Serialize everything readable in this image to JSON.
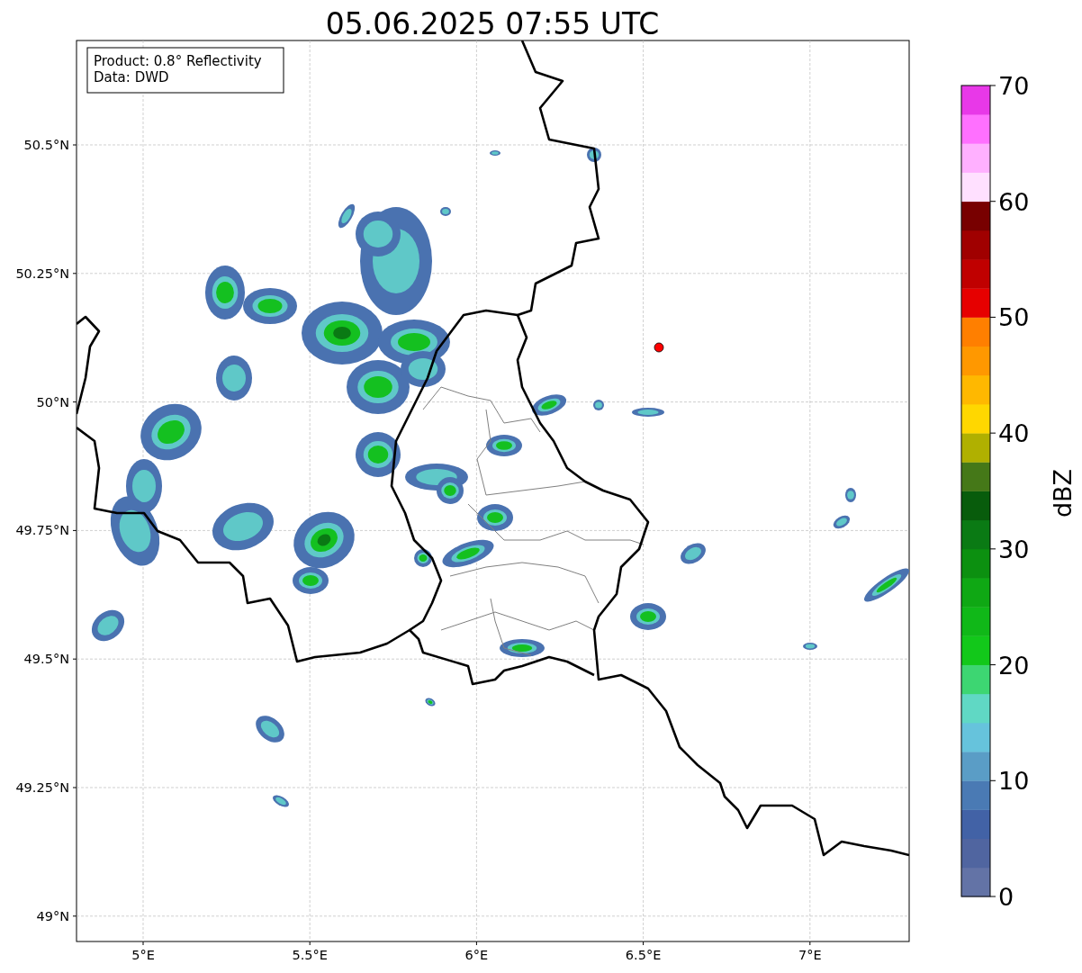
{
  "title": "05.06.2025 07:55 UTC",
  "annotation": {
    "lines": [
      "Product: 0.8° Reflectivity",
      "Data: DWD"
    ]
  },
  "map": {
    "y_tick_labels": [
      "50.5°N",
      "50.25°N",
      "50°N",
      "49.75°N",
      "49.5°N",
      "49.25°N",
      "49°N"
    ],
    "x_tick_labels": [
      "5°E",
      "5.5°E",
      "6°E",
      "6.5°E",
      "7°E"
    ]
  },
  "colorbar": {
    "label": "dBZ",
    "tick_labels": [
      "70",
      "60",
      "50",
      "40",
      "30",
      "20",
      "10",
      "0"
    ],
    "segments": [
      {
        "color": "#6373a6"
      },
      {
        "color": "#5065a0"
      },
      {
        "color": "#4262a6"
      },
      {
        "color": "#4a7ab4"
      },
      {
        "color": "#5a9dc6"
      },
      {
        "color": "#66c3dc"
      },
      {
        "color": "#60d8c4"
      },
      {
        "color": "#3dd672"
      },
      {
        "color": "#12c81a"
      },
      {
        "color": "#10b818"
      },
      {
        "color": "#0fa814"
      },
      {
        "color": "#0c9010"
      },
      {
        "color": "#0a7a14"
      },
      {
        "color": "#085c0c"
      },
      {
        "color": "#457818"
      },
      {
        "color": "#b0b000"
      },
      {
        "color": "#ffd700"
      },
      {
        "color": "#ffb800"
      },
      {
        "color": "#ff9800"
      },
      {
        "color": "#ff7f00"
      },
      {
        "color": "#e60000"
      },
      {
        "color": "#c00000"
      },
      {
        "color": "#a00000"
      },
      {
        "color": "#780000"
      },
      {
        "color": "#ffe0ff"
      },
      {
        "color": "#ffb0ff"
      },
      {
        "color": "#ff70ff"
      },
      {
        "color": "#e838e8"
      }
    ]
  }
}
